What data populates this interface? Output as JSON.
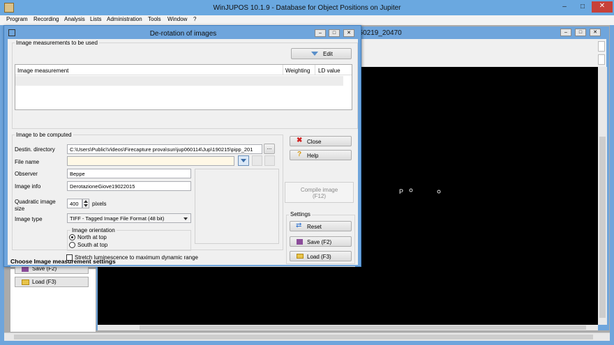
{
  "main": {
    "title": "WinJUPOS 10.1.9 - Database for Object Positions on Jupiter",
    "menu": [
      "Program",
      "Recording",
      "Analysis",
      "Lists",
      "Administration",
      "Tools",
      "Window",
      "?"
    ]
  },
  "image_window": {
    "title_fragment": "150219_20470",
    "planet_marker": "P"
  },
  "left_panel": {
    "save_label": "Save (F2)",
    "load_label": "Load (F3)"
  },
  "dialog": {
    "title": "De-rotation of images",
    "measurements_group": "Image measurements to be used",
    "edit_button": "Edit",
    "table_headers": [
      "Image measurement",
      "Weighting",
      "LD value"
    ],
    "compute_group": "Image to be computed",
    "fields": {
      "destin_label": "Destin. directory",
      "destin_value": "C:\\Users\\Public\\Videos\\Firecapture prova\\sun\\jup060114\\Jup\\190215\\pipp_201",
      "browse_label": "...",
      "filename_label": "File name",
      "filename_value": "",
      "observer_label": "Observer",
      "observer_value": "Beppe",
      "imageinfo_label": "Image info",
      "imageinfo_value": "DerotazioneGiove19022015",
      "size_label": "Quadratic image size",
      "size_value": "400",
      "size_unit": "pixels",
      "type_label": "Image type",
      "type_value": "TIFF - Tagged Image File Format (48 bit)"
    },
    "orientation": {
      "label": "Image orientation",
      "options": [
        "North at top",
        "South at top"
      ],
      "selected": "North at top"
    },
    "stretch_label": "Stretch luminescence to maximum dynamic range",
    "close_button": "Close",
    "help_button": "Help",
    "compile_button_line1": "Compile image",
    "compile_button_line2": "(F12)",
    "settings_group": "Settings",
    "reset_button": "Reset",
    "save_button": "Save (F2)",
    "load_button": "Load (F3)",
    "status_text": "Choose Image measurement settings"
  },
  "colors": {
    "title_bar": "#6fa5dc",
    "close_caption": "#c7413a",
    "filename_bg": "#fff8e6"
  }
}
